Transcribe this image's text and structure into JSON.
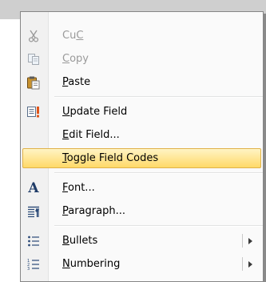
{
  "menu": {
    "items": [
      {
        "key": "C",
        "before": "Cu",
        "after": "",
        "label": "Cut",
        "icon": "scissors-icon",
        "enabled": false
      },
      {
        "key": "C",
        "before": "",
        "after": "opy",
        "label": "Copy",
        "icon": "copy-icon",
        "enabled": false
      },
      {
        "key": "P",
        "before": "",
        "after": "aste",
        "label": "Paste",
        "icon": "paste-icon",
        "enabled": true
      },
      {
        "key": "U",
        "before": "",
        "after": "pdate Field",
        "label": "Update Field",
        "icon": "update-field-icon",
        "enabled": true
      },
      {
        "key": "E",
        "before": "",
        "after": "dit Field...",
        "label": "Edit Field...",
        "icon": "",
        "enabled": true
      },
      {
        "key": "T",
        "before": "",
        "after": "oggle Field Codes",
        "label": "Toggle Field Codes",
        "icon": "",
        "enabled": true,
        "highlighted": true
      },
      {
        "key": "F",
        "before": "",
        "after": "ont...",
        "label": "Font...",
        "icon": "font-icon",
        "enabled": true
      },
      {
        "key": "P",
        "before": "",
        "after": "aragraph...",
        "label": "Paragraph...",
        "icon": "paragraph-icon",
        "enabled": true
      },
      {
        "key": "B",
        "before": "",
        "after": "ullets",
        "label": "Bullets",
        "icon": "bullets-icon",
        "enabled": true,
        "submenu": true
      },
      {
        "key": "N",
        "before": "",
        "after": "umbering",
        "label": "Numbering",
        "icon": "numbering-icon",
        "enabled": true,
        "submenu": true
      }
    ],
    "accent_highlight": "#ffd968"
  }
}
